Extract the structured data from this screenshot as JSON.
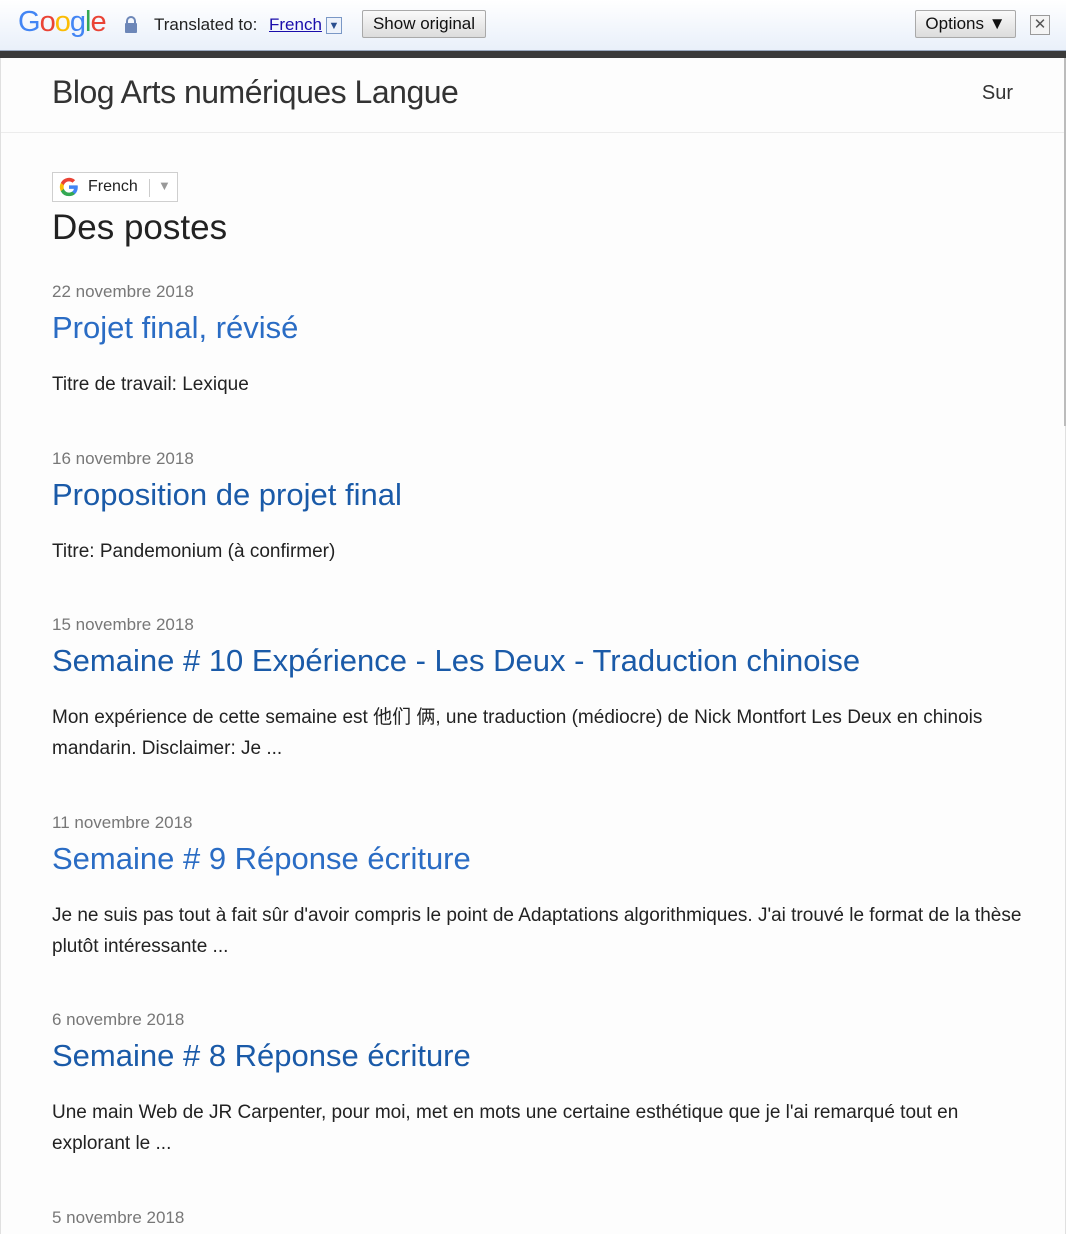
{
  "translate_bar": {
    "logo": "Google",
    "translated_label": "Translated to:",
    "language": "French",
    "show_original": "Show original",
    "options": "Options ▼",
    "close": "✕"
  },
  "header": {
    "blog_title": "Blog Arts numériques Langue",
    "about": "Sur"
  },
  "language_widget": {
    "language": "French",
    "arrow": "▼"
  },
  "section_title": "Des postes",
  "posts": [
    {
      "date": "22 novembre 2018",
      "title": "Projet final, révisé",
      "excerpt": "Titre de travail: Lexique"
    },
    {
      "date": "16 novembre 2018",
      "title": "Proposition de projet final",
      "excerpt": "Titre: Pandemonium (à confirmer)"
    },
    {
      "date": "15 novembre 2018",
      "title": "Semaine # 10 Expérience - Les Deux - Traduction chinoise",
      "excerpt": "Mon expérience de cette semaine est 他们 俩, une traduction (médiocre) de Nick Montfort Les Deux en chinois mandarin. Disclaimer: Je ..."
    },
    {
      "date": "11 novembre 2018",
      "title": "Semaine # 9 Réponse écriture",
      "excerpt": "Je ne suis pas tout à fait sûr d'avoir compris le point de Adaptations algorithmiques. J'ai trouvé le format de la thèse plutôt intéressante ..."
    },
    {
      "date": "6 novembre 2018",
      "title": "Semaine # 8 Réponse écriture",
      "excerpt": "Une main Web de JR Carpenter, pour moi, met en mots une certaine esthétique que je l'ai remarqué tout en explorant le ..."
    },
    {
      "date": "5 novembre 2018"
    }
  ]
}
